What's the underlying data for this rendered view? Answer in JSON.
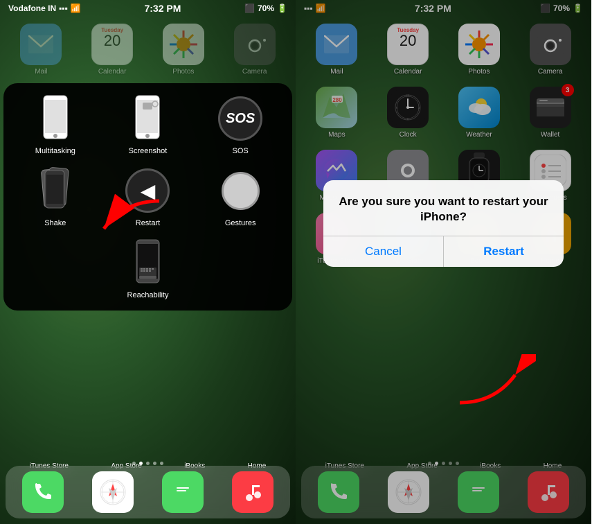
{
  "left": {
    "statusBar": {
      "carrier": "Vodafone IN",
      "signal": "●●●",
      "wifi": "wifi",
      "time": "7:32 PM",
      "bluetooth": "B",
      "battery": "70%"
    },
    "topApps": [
      {
        "id": "mail",
        "label": "Mail",
        "icon": "✉"
      },
      {
        "id": "calendar",
        "label": "Calendar",
        "icon": "cal"
      },
      {
        "id": "photos",
        "label": "Photos",
        "icon": "🌸"
      },
      {
        "id": "camera",
        "label": "Camera",
        "icon": "📷"
      }
    ],
    "assistive": {
      "items": [
        {
          "id": "multitasking",
          "label": "Multitasking",
          "type": "phone-front"
        },
        {
          "id": "screenshot",
          "label": "Screenshot",
          "type": "phone-screenshot"
        },
        {
          "id": "sos",
          "label": "SOS",
          "type": "sos"
        },
        {
          "id": "shake",
          "label": "Shake",
          "type": "phone-stack"
        },
        {
          "id": "restart",
          "label": "Restart",
          "type": "restart"
        },
        {
          "id": "gestures",
          "label": "Gestures",
          "type": "gestures"
        },
        {
          "id": "reachability",
          "label": "Reachability",
          "type": "phone-keyboard"
        }
      ]
    },
    "dockLabels": [
      "iTunes Store",
      "App Store",
      "iBooks",
      "Home"
    ],
    "dockIcons": [
      {
        "id": "itunes",
        "label": "iTunes Store",
        "icon": "★"
      },
      {
        "id": "appstore",
        "label": "App Store",
        "icon": "A"
      },
      {
        "id": "ibooks",
        "label": "iBooks",
        "icon": "📖"
      },
      {
        "id": "home-app",
        "label": "Home",
        "icon": "🏠"
      }
    ],
    "bottomDock": [
      {
        "id": "phone",
        "label": "",
        "icon": "📞"
      },
      {
        "id": "safari",
        "label": "",
        "icon": "🧭"
      },
      {
        "id": "messages",
        "label": "",
        "icon": "💬"
      },
      {
        "id": "music",
        "label": "",
        "icon": "🎵"
      }
    ]
  },
  "right": {
    "statusBar": {
      "carrier": "",
      "time": "7:32 PM",
      "battery": "70%"
    },
    "topApps": [
      {
        "id": "mail",
        "label": "Mail",
        "icon": "✉"
      },
      {
        "id": "calendar",
        "label": "Calendar",
        "icon": "cal"
      },
      {
        "id": "photos",
        "label": "Photos",
        "icon": "🌸"
      },
      {
        "id": "camera",
        "label": "Camera",
        "icon": "📷"
      }
    ],
    "secondRow": [
      {
        "id": "maps",
        "label": "Maps",
        "icon": "🗺"
      },
      {
        "id": "clock",
        "label": "Clock",
        "icon": "🕐"
      },
      {
        "id": "weather",
        "label": "Weather",
        "icon": "⛅"
      },
      {
        "id": "wallet",
        "label": "Wallet",
        "icon": "💳",
        "badge": "3"
      }
    ],
    "thirdRow": [
      {
        "id": "messenger",
        "label": "Messenger",
        "icon": "m"
      },
      {
        "id": "settings",
        "label": "Settings",
        "icon": "⚙"
      },
      {
        "id": "watch",
        "label": "Watch",
        "icon": "⌚"
      },
      {
        "id": "reminders",
        "label": "Reminders",
        "icon": "✓"
      }
    ],
    "fourthRow": [
      {
        "id": "itunes",
        "label": "iTunes Store",
        "icon": "★"
      },
      {
        "id": "appstore",
        "label": "App Store",
        "icon": "A"
      },
      {
        "id": "ibooks",
        "label": "iBooks",
        "icon": "📖"
      },
      {
        "id": "home-app",
        "label": "Home",
        "icon": "🏠"
      }
    ],
    "dialog": {
      "title": "Are you sure you want to restart your iPhone?",
      "cancelLabel": "Cancel",
      "confirmLabel": "Restart"
    },
    "dockLabels": [
      "iTunes Store",
      "App Store",
      "iBooks",
      "Home"
    ],
    "bottomDock": [
      {
        "id": "phone",
        "icon": "📞"
      },
      {
        "id": "safari",
        "icon": "🧭"
      },
      {
        "id": "messages",
        "icon": "💬"
      },
      {
        "id": "music",
        "icon": "🎵"
      }
    ]
  }
}
